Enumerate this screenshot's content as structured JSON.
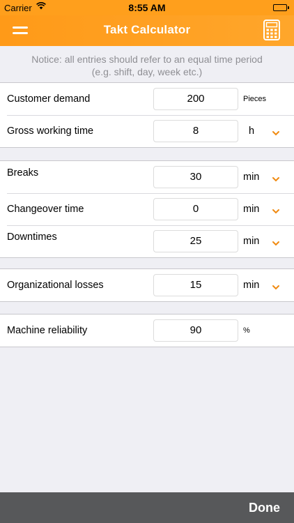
{
  "status_bar": {
    "carrier": "Carrier",
    "time": "8:55 AM"
  },
  "nav": {
    "title": "Takt Calculator",
    "menu_icon": "menu-icon",
    "calculator_icon": "calculator-icon"
  },
  "notice": "Notice: all entries should refer to an equal time period (e.g. shift, day, week etc.)",
  "sections": [
    {
      "rows": [
        {
          "label": "Customer demand",
          "value": "200",
          "unit": "Pieces"
        },
        {
          "label": "Gross working time",
          "value": "8",
          "unit": "h"
        }
      ]
    },
    {
      "rows": [
        {
          "label": "Breaks",
          "value": "30",
          "unit": "min"
        },
        {
          "label": "Changeover time",
          "value": "0",
          "unit": "min"
        },
        {
          "label": "Downtimes",
          "value": "25",
          "unit": "min"
        }
      ]
    },
    {
      "rows": [
        {
          "label": "Organizational losses",
          "value": "15",
          "unit": "min"
        }
      ]
    },
    {
      "rows": [
        {
          "label": "Machine reliability",
          "value": "90",
          "unit": "%"
        }
      ]
    }
  ],
  "footer": {
    "done_label": "Done"
  },
  "colors": {
    "accent": "#ff9f1c",
    "chevron": "#f08a10",
    "footer": "#57585a"
  }
}
